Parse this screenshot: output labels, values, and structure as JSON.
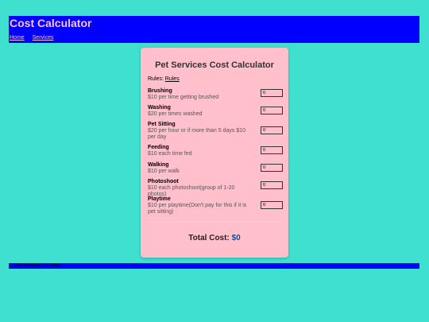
{
  "header": {
    "title": "Cost Calculator",
    "nav": [
      "Home",
      "Services"
    ]
  },
  "calculator": {
    "title": "Pet Services Cost Calculator",
    "rules_label": "Rules:",
    "rules_link": "Rules",
    "items": [
      {
        "name": "Brushing",
        "desc": "$10 per time getting brushed",
        "value": "0"
      },
      {
        "name": "Washing",
        "desc": "$20 per times washed",
        "value": "0"
      },
      {
        "name": "Pet Sitting",
        "desc": "$20 per hour or if more than 5 days $10 per day",
        "value": "0"
      },
      {
        "name": "Feeding",
        "desc": "$10 each time fed",
        "value": "0"
      },
      {
        "name": "Walking",
        "desc": "$10 per walk",
        "value": "0"
      },
      {
        "name": "Photoshoot",
        "desc": "$10 each photoshoot(group of 1-20 photos)",
        "value": "0"
      },
      {
        "name": "Playtime",
        "desc": "$10 per playtime(Don't pay for this if it is pet sitting)",
        "value": "0"
      }
    ],
    "total_label": "Total Cost:",
    "total_value": "$0"
  },
  "footer": {
    "text": "© 2025 Awesome Pet Sitters"
  },
  "colors": {
    "background": "#40e0d0",
    "header": "#0000ff",
    "card": "#ffc0cb"
  }
}
